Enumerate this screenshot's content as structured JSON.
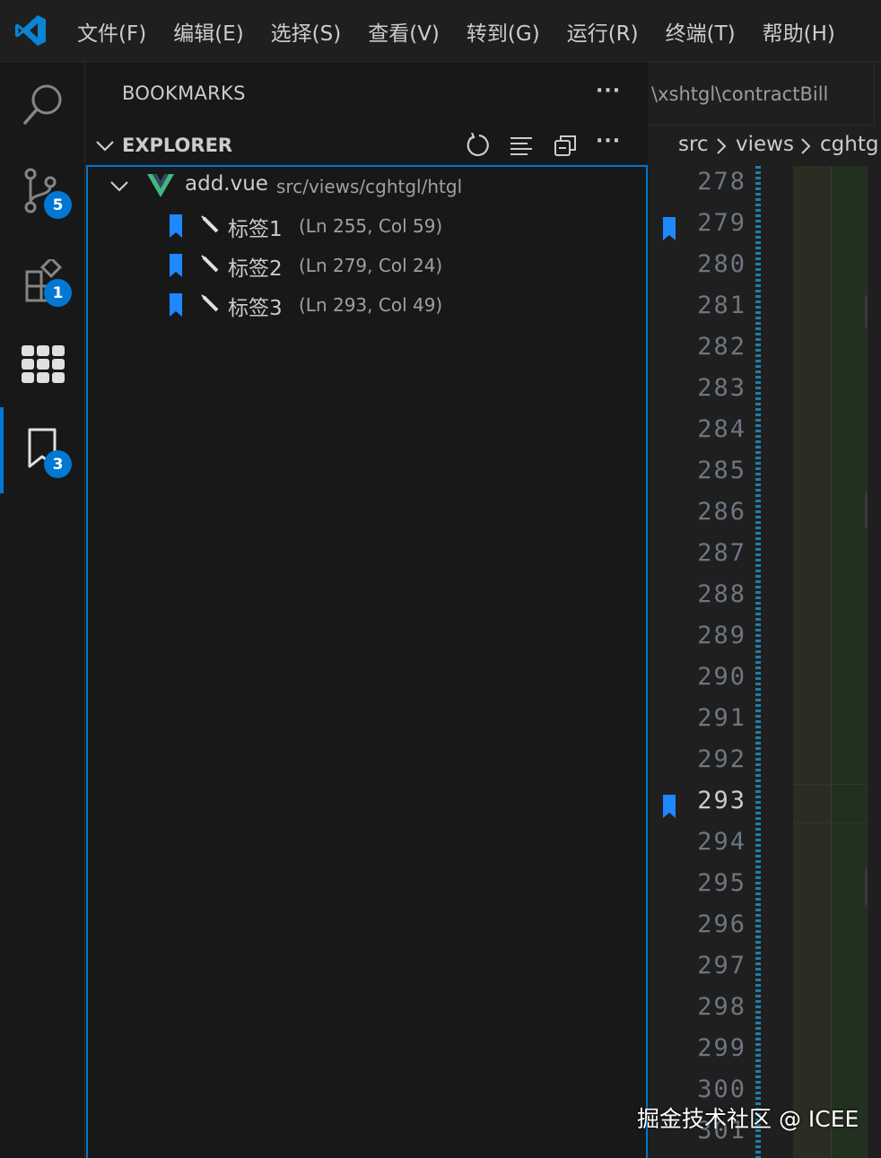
{
  "menu": {
    "items": [
      "文件(F)",
      "编辑(E)",
      "选择(S)",
      "查看(V)",
      "转到(G)",
      "运行(R)",
      "终端(T)",
      "帮助(H)"
    ]
  },
  "activity_bar": {
    "source_control_badge": "5",
    "extensions_badge": "1",
    "bookmarks_badge": "3"
  },
  "sidebar": {
    "bookmarks_title": "BOOKMARKS",
    "explorer_title": "EXPLORER",
    "file": {
      "name": "add.vue",
      "path": "src/views/cghtgl/htgl"
    },
    "bookmarks": [
      {
        "label": "标签1",
        "location": "(Ln 255, Col 59)"
      },
      {
        "label": "标签2",
        "location": "(Ln 279, Col 24)"
      },
      {
        "label": "标签3",
        "location": "(Ln 293, Col 49)"
      }
    ]
  },
  "editor": {
    "tab_label": "\\xshtgl\\contractBill",
    "breadcrumb": [
      "src",
      "views",
      "cghtg"
    ],
    "line_numbers": [
      "278",
      "279",
      "280",
      "281",
      "282",
      "283",
      "284",
      "285",
      "286",
      "287",
      "288",
      "289",
      "290",
      "291",
      "292",
      "293",
      "294",
      "295",
      "296",
      "297",
      "298",
      "299",
      "300",
      "301"
    ],
    "bookmarked_lines": [
      "279",
      "293"
    ],
    "active_line": "293"
  },
  "watermark": "掘金技术社区 @ ICEE",
  "colors": {
    "accent": "#0078d4",
    "bookmark": "#1e88ff",
    "vue_green": "#41b883"
  }
}
